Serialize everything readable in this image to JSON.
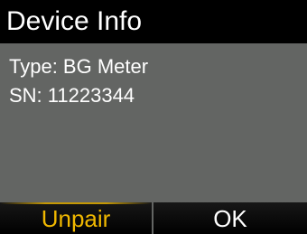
{
  "screen": {
    "title": "Device Info"
  },
  "device": {
    "type_line": "Type: BG Meter",
    "sn_line": "SN: 11223344"
  },
  "softkeys": {
    "left_label": "Unpair",
    "right_label": "OK"
  },
  "colors": {
    "background": "#636563",
    "title_bar": "#000000",
    "accent": "#f0b800",
    "text": "#ffffff"
  }
}
